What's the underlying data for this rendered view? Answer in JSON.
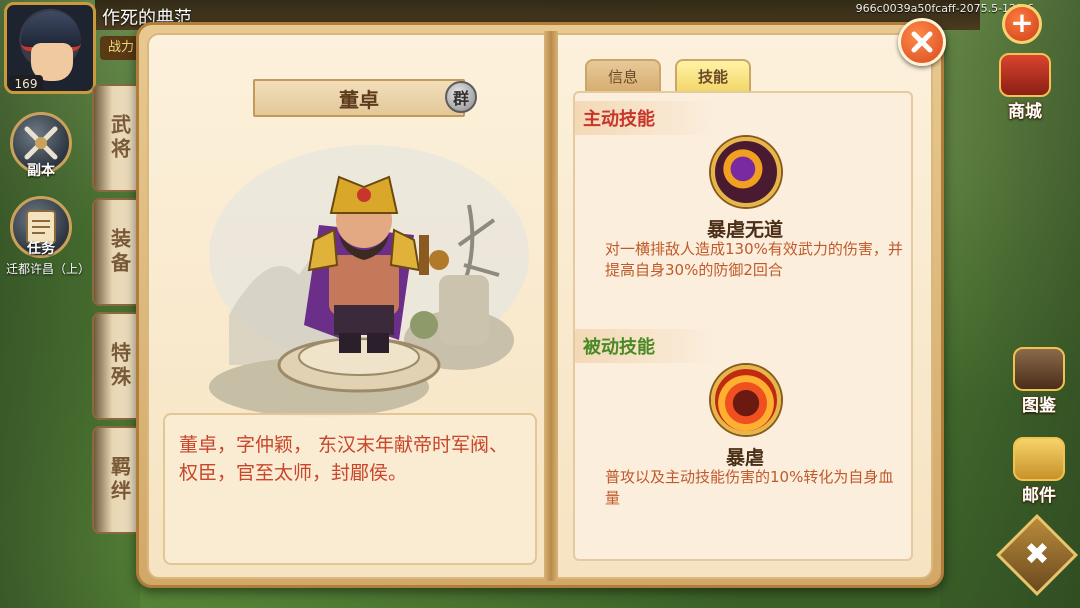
{
  "window": {
    "version_id": "966c0039a50fcaff-2075.5-121-6"
  },
  "player": {
    "name": "作死的典范",
    "level": "169",
    "power_label": "战力"
  },
  "left_hud": {
    "instance_label": "副本",
    "task_label": "任务",
    "task_sub": "迁都许昌（上）",
    "side_tabs": [
      "武将",
      "装备",
      "特殊",
      "羁绊"
    ]
  },
  "right_hud": {
    "shop_label": "商城",
    "gallery_label": "图鉴",
    "mail_label": "邮件"
  },
  "hero": {
    "name": "董卓",
    "faction_badge": "群",
    "description": "董卓，字仲颖， 东汉末年献帝时军阀、权臣，官至太师，封郿侯。"
  },
  "tabs": [
    {
      "label": "信息",
      "active": false
    },
    {
      "label": "技能",
      "active": true
    }
  ],
  "skills": {
    "active_header": "主动技能",
    "passive_header": "被动技能",
    "active": {
      "icon": "bell-tower-icon",
      "name": "暴虐无道",
      "description": "对一横排敌人造成130%有效武力的伤害，并提高自身30%的防御2回合"
    },
    "passive": {
      "icon": "fire-silhouette-icon",
      "name": "暴虐",
      "description": "普攻以及主动技能伤害的10%转化为自身血量"
    }
  },
  "colors": {
    "active_header": "#c8352a",
    "passive_header": "#4a8a25",
    "description_text": "#c8462a",
    "book_border": "#b07d3a"
  }
}
